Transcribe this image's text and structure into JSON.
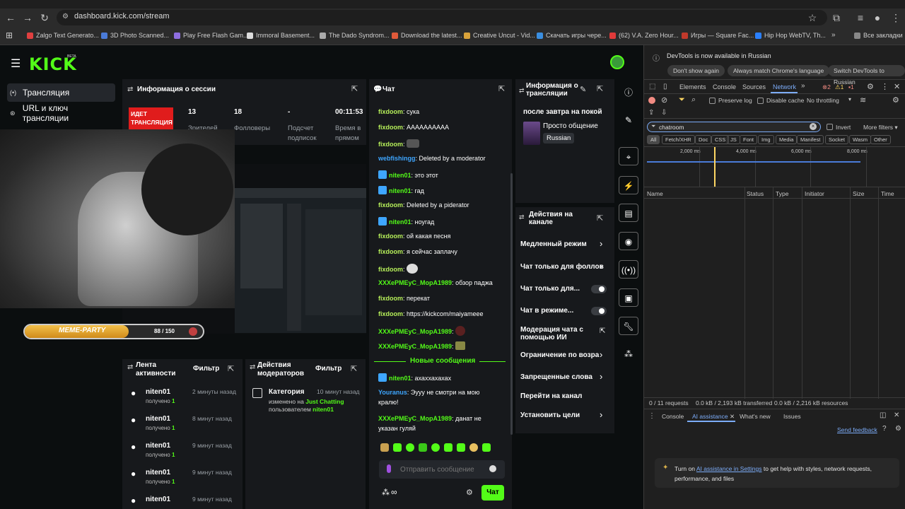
{
  "browser": {
    "url": "dashboard.kick.com/stream",
    "bookmarks": [
      {
        "label": "Zalgo Text Generato...",
        "color": "#e04040"
      },
      {
        "label": "3D Photo Scanned...",
        "color": "#4a7bd8"
      },
      {
        "label": "Play Free Flash Gam...",
        "color": "#8e6ee0"
      },
      {
        "label": "Immoral Basement...",
        "color": "#dddddd"
      },
      {
        "label": "The Dado Syndrom...",
        "color": "#aaaaaa"
      },
      {
        "label": "Download the latest...",
        "color": "#e05a3a"
      },
      {
        "label": "Creative Uncut - Vid...",
        "color": "#d8a23a"
      },
      {
        "label": "Скачать игры чере...",
        "color": "#3a8ee0"
      },
      {
        "label": "(62) V.A. Zero Hour...",
        "color": "#e03a3a"
      },
      {
        "label": "Игры — Square Fac...",
        "color": "#c0392b"
      },
      {
        "label": "Hip Hop WebTV, Th...",
        "color": "#2a80ff"
      }
    ],
    "all_bookmarks": "Все закладки"
  },
  "kick": {
    "logo": "KICK",
    "logo_badge": "BETA",
    "sidebar": [
      {
        "label": "Трансляция",
        "icon": "broadcast-icon"
      },
      {
        "label": "URL и ключ трансляции",
        "icon": "key-icon"
      }
    ],
    "session": {
      "title": "Информация о сессии",
      "live_badge": "ИДЕТ ТРАНСЛЯЦИЯ",
      "viewers": "13",
      "viewers_label": "Зрителей",
      "followers": "18",
      "followers_label": "Фолловеры",
      "subs": "-",
      "subs_label": "Подсчет подписок",
      "time": "00:11:53",
      "time_label": "Время в прямом"
    },
    "overlay": {
      "label": "MEME-PARTY",
      "counter": "88 / 150"
    },
    "chat": {
      "title": "Чат",
      "messages": [
        {
          "user": "fixdoom",
          "color": "#b7f05a",
          "text": "сука",
          "mod": false
        },
        {
          "user": "fixdoom",
          "color": "#b7f05a",
          "text": "АААААААААА",
          "mod": false
        },
        {
          "user": "fixdoom",
          "color": "#b7f05a",
          "text": "",
          "mod": false
        },
        {
          "user": "webfishingg",
          "color": "#3ea6ff",
          "text": "Deleted by a moderator",
          "mod": false
        },
        {
          "user": "niten01",
          "color": "#53fc18",
          "text": "это этот",
          "mod": true
        },
        {
          "user": "niten01",
          "color": "#53fc18",
          "text": "гад",
          "mod": true
        },
        {
          "user": "fixdoom",
          "color": "#b7f05a",
          "text": "Deleted by a piderator",
          "mod": false
        },
        {
          "user": "niten01",
          "color": "#53fc18",
          "text": "ноугад",
          "mod": true
        },
        {
          "user": "fixdoom",
          "color": "#b7f05a",
          "text": "ой какая песня",
          "mod": false
        },
        {
          "user": "fixdoom",
          "color": "#b7f05a",
          "text": "я сейчас заплачу",
          "mod": false
        },
        {
          "user": "fixdoom",
          "color": "#b7f05a",
          "text": "",
          "mod": false
        },
        {
          "user": "XXXePMEyC_MopA1989",
          "color": "#53fc18",
          "text": "обзор паджа",
          "mod": false
        },
        {
          "user": "fixdoom",
          "color": "#b7f05a",
          "text": "перекат",
          "mod": false
        },
        {
          "user": "fixdoom",
          "color": "#b7f05a",
          "text": "https://kickcom/maiyameee",
          "mod": false
        },
        {
          "user": "XXXePMEyC_MopA1989",
          "color": "#53fc18",
          "text": "",
          "mod": false
        },
        {
          "user": "XXXePMEyC_MopA1989",
          "color": "#53fc18",
          "text": "",
          "mod": false
        }
      ],
      "new_messages": "Новые сообщения",
      "messages_after": [
        {
          "user": "niten01",
          "color": "#53fc18",
          "text": "ахаххахахах",
          "mod": true
        },
        {
          "user": "Youranus",
          "color": "#3ea6ff",
          "text": "Эууу не смотри на мою",
          "text2": "кралю!"
        },
        {
          "user": "XXXePMEyC_MopA1989",
          "color": "#53fc18",
          "text": "данат не",
          "text2": "указан гуляй"
        }
      ],
      "input_placeholder": "Отправить сообщение",
      "send": "Чат"
    },
    "stream_info": {
      "title": "Информация о трансляции",
      "stream_title": "после завтра на покой",
      "category": "Просто общение",
      "language": "Russian"
    },
    "channel_actions": {
      "title": "Действия на канале",
      "items": [
        {
          "label": "Медленный режим",
          "kind": "chevron"
        },
        {
          "label": "Чат только для фоллов",
          "kind": "chevron"
        },
        {
          "label": "Чат только для...",
          "kind": "toggle"
        },
        {
          "label": "Чат в режиме...",
          "kind": "toggle"
        },
        {
          "label": "Модерация чата с",
          "label2": "помощью ИИ",
          "kind": "external"
        },
        {
          "label": "Ограничение по возра",
          "kind": "chevron"
        },
        {
          "label": "Запрещенные слова",
          "kind": "chevron"
        },
        {
          "label": "Перейти на канал",
          "kind": "none"
        },
        {
          "label": "Установить цели",
          "kind": "chevron"
        }
      ]
    },
    "activity": {
      "title": "Лента активности",
      "filter": "Фильтр",
      "items": [
        {
          "user": "niten01",
          "sub": "получено",
          "count": "1",
          "time": "2 минуты назад"
        },
        {
          "user": "niten01",
          "sub": "получено",
          "count": "1",
          "time": "8 минут назад"
        },
        {
          "user": "niten01",
          "sub": "получено",
          "count": "1",
          "time": "9 минут назад"
        },
        {
          "user": "niten01",
          "sub": "получено",
          "count": "1",
          "time": "9 минут назад"
        },
        {
          "user": "niten01",
          "sub": "",
          "count": "",
          "time": "9 минут назад"
        }
      ]
    },
    "mod_actions": {
      "title": "Действия модераторов",
      "filter": "Фильтр",
      "item": {
        "title": "Категория",
        "time": "10 минут назад",
        "line1": "изменено на",
        "value": "Just Chatting",
        "line2": "пользователем",
        "user": "niten01"
      }
    }
  },
  "devtools": {
    "banner": "DevTools is now available in Russian",
    "btn_dont_show": "Don't show again",
    "btn_match": "Always match Chrome's language",
    "btn_switch": "Switch DevTools to Russian",
    "tabs": [
      "Elements",
      "Console",
      "Sources",
      "Network"
    ],
    "active_tab": "Network",
    "errors": "2",
    "warnings": "1",
    "issues": "1",
    "preserve_log": "Preserve log",
    "disable_cache": "Disable cache",
    "throttling": "No throttling",
    "filter_value": "chatroom",
    "invert": "Invert",
    "more_filters": "More filters",
    "types": [
      "All",
      "Fetch/XHR",
      "Doc",
      "CSS",
      "JS",
      "Font",
      "Img",
      "Media",
      "Manifest",
      "Socket",
      "Wasm",
      "Other"
    ],
    "ticks": [
      "2,000 ms",
      "4,000 ms",
      "6,000 ms",
      "8,000 ms"
    ],
    "columns": [
      "Name",
      "Status",
      "Type",
      "Initiator",
      "Size",
      "Time"
    ],
    "status_bar": {
      "requests": "0 / 11 requests",
      "transferred": "0.0 kB / 2,193 kB transferred",
      "resources": "0.0 kB / 2,216 kB resources"
    },
    "drawer_tabs": [
      "Console",
      "AI assistance",
      "What's new",
      "Issues"
    ],
    "send_feedback": "Send feedback",
    "ai_text_pre": "Turn on",
    "ai_link": "AI assistance in Settings",
    "ai_text_post": "to get help with styles, network requests,",
    "ai_text_line2": "performance, and files"
  }
}
